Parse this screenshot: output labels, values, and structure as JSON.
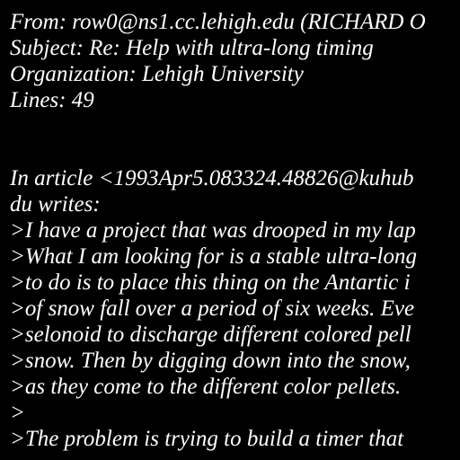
{
  "colors": {
    "background": "#000000",
    "text": "#ffffff"
  },
  "header": {
    "from": "From: row0@ns1.cc.lehigh.edu (RICHARD O",
    "subject": "Subject: Re: Help with ultra-long timing",
    "organization": "Organization: Lehigh University",
    "lines": "Lines: 49"
  },
  "body": {
    "attribution_1": "In article <1993Apr5.083324.48826@kuhub",
    "attribution_2": "du writes:",
    "quoted": [
      ">I have a project that was drooped in my lap",
      ">What I am looking for is a stable ultra-long",
      ">to do is to place this thing on the Antartic i",
      ">of snow fall over a period of six weeks. Eve",
      ">selonoid to discharge different colored pell",
      ">snow. Then by digging down into the snow,",
      ">as they come to the different color pellets.",
      ">",
      ">The problem is trying to build a timer that"
    ]
  }
}
